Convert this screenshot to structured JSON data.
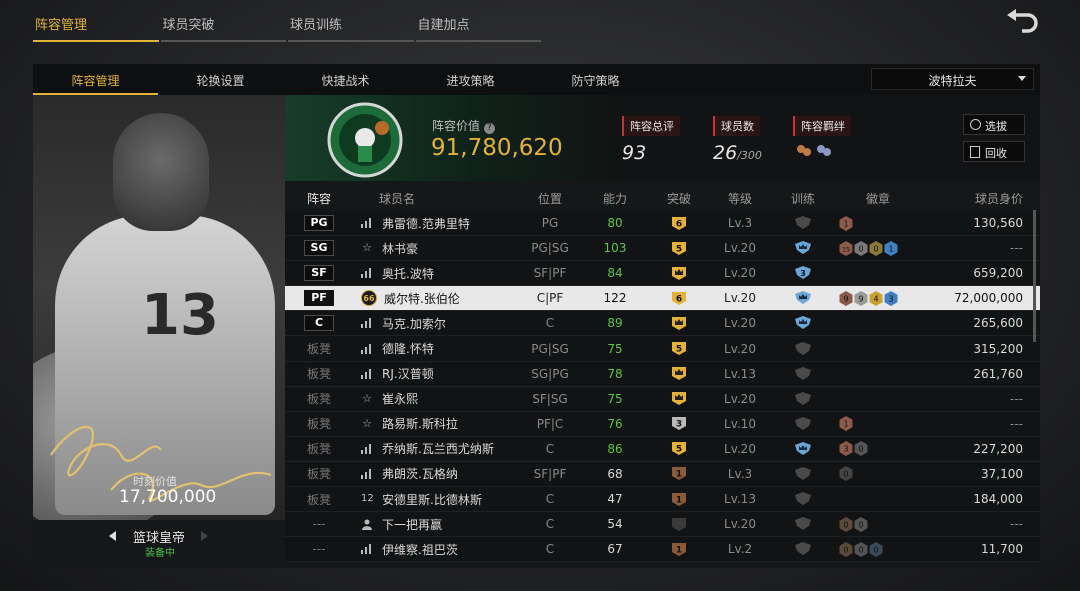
{
  "top_tabs": [
    "阵容管理",
    "球员突破",
    "球员训练",
    "自建加点"
  ],
  "sub_tabs": [
    "阵容管理",
    "轮换设置",
    "快捷战术",
    "进攻策略",
    "防守策略"
  ],
  "team_selector": "波特拉夫",
  "card": {
    "value_label": "时刻价值",
    "value": "17,700,000",
    "title": "篮球皇帝",
    "status": "装备中",
    "jersey_number": "13"
  },
  "summary": {
    "team_value_label": "阵容价值",
    "team_value": "91,780,620",
    "rating_label": "阵容总评",
    "rating": "93",
    "players_label": "球员数",
    "players": "26",
    "players_max": "/300",
    "bond_label": "阵容羁绊",
    "scout_button": "选拔",
    "recycle_button": "回收"
  },
  "table": {
    "headers": {
      "pos": "阵容",
      "name": "球员名",
      "position": "位置",
      "ability": "能力",
      "breakthrough": "突破",
      "level": "等级",
      "training": "训练",
      "badges": "徽章",
      "salary": "球员身价"
    },
    "rows": [
      {
        "slot": "PG",
        "icon": "bars",
        "name": "弗雷德.范弗里特",
        "position": "PG",
        "ability": "80",
        "ability_green": true,
        "brk": "6",
        "brk_type": "gold",
        "level": "Lv.3",
        "train": "dark",
        "badges": [
          {
            "t": "1",
            "c": "#8a5a4a"
          }
        ],
        "salary": "130,560"
      },
      {
        "slot": "SG",
        "icon": "star",
        "name": "林书豪",
        "position": "PG|SG",
        "ability": "103",
        "ability_green": true,
        "brk": "5",
        "brk_type": "gold",
        "level": "Lv.20",
        "train": "blue",
        "badges": [
          {
            "t": "15",
            "c": "#8a5a4a"
          },
          {
            "t": "0",
            "c": "#7a7a7a"
          },
          {
            "t": "0",
            "c": "#8a7a3a"
          },
          {
            "t": "1",
            "c": "#3f7fc2"
          }
        ],
        "salary": "---"
      },
      {
        "slot": "SF",
        "icon": "bars",
        "name": "奥托.波特",
        "position": "SF|PF",
        "ability": "84",
        "ability_green": true,
        "brk": "crown",
        "brk_type": "gold",
        "level": "Lv.20",
        "train": "blue3",
        "badges": [],
        "salary": "659,200"
      },
      {
        "slot": "PF",
        "icon": "66",
        "name": "威尔特.张伯伦",
        "position": "C|PF",
        "ability": "122",
        "ability_green": false,
        "brk": "6",
        "brk_type": "gold",
        "level": "Lv.20",
        "train": "blue",
        "badges": [
          {
            "t": "9",
            "c": "#8a5a4a"
          },
          {
            "t": "9",
            "c": "#9a9a9a"
          },
          {
            "t": "4",
            "c": "#c9a12e"
          },
          {
            "t": "3",
            "c": "#3f7fc2"
          }
        ],
        "salary": "72,000,000",
        "selected": true
      },
      {
        "slot": "C",
        "icon": "bars",
        "name": "马克.加索尔",
        "position": "C",
        "ability": "89",
        "ability_green": true,
        "brk": "crown",
        "brk_type": "gold",
        "level": "Lv.20",
        "train": "blue",
        "badges": [],
        "salary": "265,600"
      },
      {
        "slot": "板凳",
        "icon": "bars",
        "name": "德隆.怀特",
        "position": "PG|SG",
        "ability": "75",
        "ability_green": true,
        "brk": "5",
        "brk_type": "gold",
        "level": "Lv.20",
        "train": "dark",
        "badges": [],
        "salary": "315,200"
      },
      {
        "slot": "板凳",
        "icon": "bars",
        "name": "RJ.汉普顿",
        "position": "SG|PG",
        "ability": "78",
        "ability_green": true,
        "brk": "crown",
        "brk_type": "gold",
        "level": "Lv.13",
        "train": "dark",
        "badges": [],
        "salary": "261,760"
      },
      {
        "slot": "板凳",
        "icon": "star",
        "name": "崔永熙",
        "position": "SF|SG",
        "ability": "75",
        "ability_green": true,
        "brk": "crown",
        "brk_type": "gold",
        "level": "Lv.20",
        "train": "dark",
        "badges": [],
        "salary": "---"
      },
      {
        "slot": "板凳",
        "icon": "star",
        "name": "路易斯.斯科拉",
        "position": "PF|C",
        "ability": "76",
        "ability_green": true,
        "brk": "3",
        "brk_type": "silver",
        "level": "Lv.10",
        "train": "dark",
        "badges": [
          {
            "t": "1",
            "c": "#8a5a4a"
          }
        ],
        "salary": "---"
      },
      {
        "slot": "板凳",
        "icon": "bars",
        "name": "乔纳斯.瓦兰西尤纳斯",
        "position": "C",
        "ability": "86",
        "ability_green": true,
        "brk": "5",
        "brk_type": "gold",
        "level": "Lv.20",
        "train": "blue",
        "badges": [
          {
            "t": "3",
            "c": "#8a5a4a"
          },
          {
            "t": "0",
            "c": "#555"
          }
        ],
        "salary": "227,200"
      },
      {
        "slot": "板凳",
        "icon": "bars",
        "name": "弗朗茨.瓦格纳",
        "position": "SF|PF",
        "ability": "68",
        "ability_green": false,
        "brk": "1",
        "brk_type": "bronze",
        "level": "Lv.3",
        "train": "dark",
        "badges": [
          {
            "t": "0",
            "c": "#444"
          }
        ],
        "salary": "37,100"
      },
      {
        "slot": "板凳",
        "icon": "12",
        "name": "安德里斯.比德林斯",
        "position": "C",
        "ability": "47",
        "ability_green": false,
        "brk": "1",
        "brk_type": "bronze",
        "level": "Lv.13",
        "train": "dark",
        "badges": [],
        "salary": "184,000"
      },
      {
        "slot": "---",
        "icon": "user",
        "name": "下一把再赢",
        "position": "C",
        "ability": "54",
        "ability_green": false,
        "brk": "",
        "brk_type": "dark",
        "level": "Lv.20",
        "train": "dark",
        "badges": [
          {
            "t": "0",
            "c": "#5a4a3a"
          },
          {
            "t": "0",
            "c": "#555"
          }
        ],
        "salary": "---"
      },
      {
        "slot": "---",
        "icon": "bars",
        "name": "伊维察.祖巴茨",
        "position": "C",
        "ability": "67",
        "ability_green": false,
        "brk": "1",
        "brk_type": "bronze",
        "level": "Lv.2",
        "train": "dark",
        "badges": [
          {
            "t": "0",
            "c": "#5a4a3a"
          },
          {
            "t": "0",
            "c": "#555"
          },
          {
            "t": "0",
            "c": "#3a4a5a"
          }
        ],
        "salary": "11,700"
      }
    ]
  }
}
